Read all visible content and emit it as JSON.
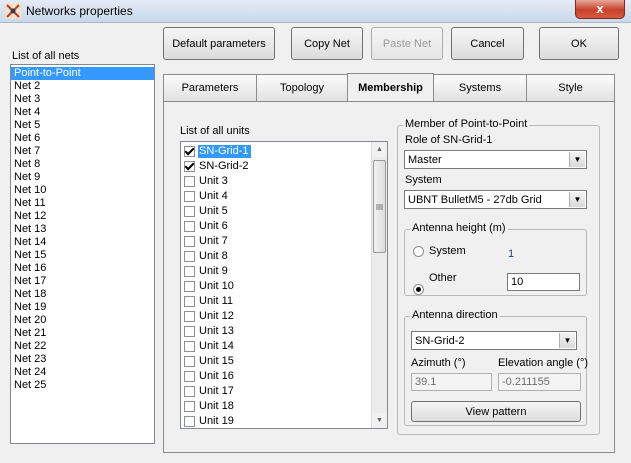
{
  "window": {
    "title": "Networks properties",
    "close_label": "x"
  },
  "toolbar": {
    "default_params": "Default parameters",
    "copy_net": "Copy Net",
    "paste_net": "Paste Net",
    "cancel": "Cancel",
    "ok": "OK"
  },
  "nets": {
    "header": "List of all nets",
    "items": [
      "Point-to-Point",
      "Net  2",
      "Net  3",
      "Net  4",
      "Net  5",
      "Net  6",
      "Net  7",
      "Net  8",
      "Net  9",
      "Net 10",
      "Net 11",
      "Net 12",
      "Net 13",
      "Net 14",
      "Net 15",
      "Net 16",
      "Net 17",
      "Net 18",
      "Net 19",
      "Net 20",
      "Net 21",
      "Net 22",
      "Net 23",
      "Net 24",
      "Net 25"
    ],
    "selected_index": 0
  },
  "tabs": [
    {
      "label": "Parameters"
    },
    {
      "label": "Topology"
    },
    {
      "label": "Membership"
    },
    {
      "label": "Systems"
    },
    {
      "label": "Style"
    }
  ],
  "active_tab": "Membership",
  "units": {
    "header": "List of all units",
    "items": [
      {
        "label": "SN-Grid-1",
        "checked": true
      },
      {
        "label": "SN-Grid-2",
        "checked": true
      },
      {
        "label": "Unit     3",
        "checked": false
      },
      {
        "label": "Unit     4",
        "checked": false
      },
      {
        "label": "Unit     5",
        "checked": false
      },
      {
        "label": "Unit     6",
        "checked": false
      },
      {
        "label": "Unit     7",
        "checked": false
      },
      {
        "label": "Unit     8",
        "checked": false
      },
      {
        "label": "Unit     9",
        "checked": false
      },
      {
        "label": "Unit   10",
        "checked": false
      },
      {
        "label": "Unit   11",
        "checked": false
      },
      {
        "label": "Unit   12",
        "checked": false
      },
      {
        "label": "Unit   13",
        "checked": false
      },
      {
        "label": "Unit   14",
        "checked": false
      },
      {
        "label": "Unit   15",
        "checked": false
      },
      {
        "label": "Unit   16",
        "checked": false
      },
      {
        "label": "Unit   17",
        "checked": false
      },
      {
        "label": "Unit   18",
        "checked": false
      },
      {
        "label": "Unit   19",
        "checked": false
      }
    ],
    "selected_index": 0
  },
  "member": {
    "group_label": "Member of Point-to-Point",
    "role_label": "Role of SN-Grid-1",
    "role_value": "Master",
    "system_label": "System",
    "system_value": "UBNT BulletM5 - 27db Grid"
  },
  "antenna_height": {
    "group_label": "Antenna height (m)",
    "system_label": "System",
    "system_value": "1",
    "other_label": "Other",
    "other_value": "10",
    "selected": "Other"
  },
  "antenna_direction": {
    "group_label": "Antenna direction",
    "target_value": "SN-Grid-2",
    "azimuth_label": "Azimuth (°)",
    "azimuth_value": "39.1",
    "elevation_label": "Elevation angle (°)",
    "elevation_value": "-0.211155",
    "view_pattern": "View pattern"
  },
  "colors": {
    "selection": "#3399ff",
    "link_value": "#1f3a93"
  }
}
